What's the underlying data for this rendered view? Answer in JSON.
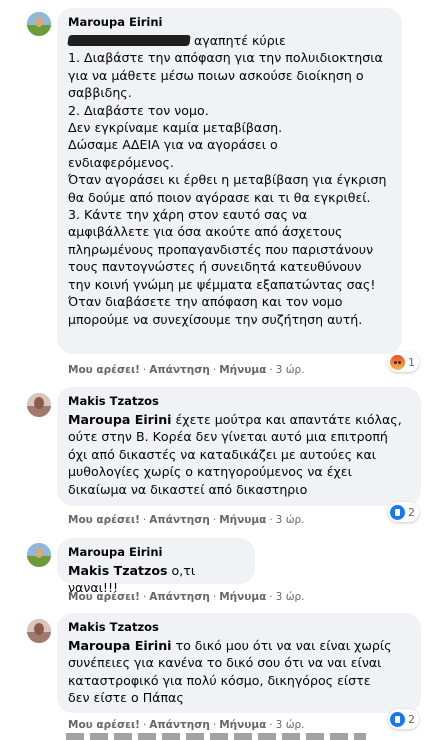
{
  "comments": [
    {
      "author": "Maroupa Eirini",
      "body_prefix": "αγαπητέ κύριε",
      "body": "1. Διαβάστε την απόφαση για την πολυιδιοκτησια\nγια να μάθετε μέσω ποιων ασκούσε διοίκηση ο\nσαββιδης.\n2. Διαβάστε τον νομο.\nΔεν εγκρίναμε καμία μεταβίβαση.\nΔώσαμε ΑΔΕΙΑ για να αγοράσει ο\nενδιαφερόμενος.\nΌταν αγοράσει κι έρθει η μεταβίβαση για έγκριση\nθα δούμε από ποιον αγόρασε και τι θα εγκριθεί.\n3. Κάντε την χάρη στον εαυτό σας να\nαμφιβάλλετε για όσα ακούτε από άσχετους\nπληρωμένους προπαγανδιστές που παριστάνουν\nτους παντογνώστες ή συνειδητά κατευθύνουν\nτην κοινή γνώμη με ψέμματα εξαπατώντας σας!\nΌταν διαβάσετε την απόφαση και τον νομο\nμπορούμε να συνεχίσουμε την συζήτηση αυτή.",
      "like": "Μου αρέσει!",
      "reply": "Απάντηση",
      "message": "Μήνυμα",
      "time": "3 ώρ.",
      "reaction_icon": "angry-reaction-icon",
      "reaction_count": "1"
    },
    {
      "author": "Makis Tzatzos",
      "mention": "Maroupa Eirini",
      "body": " έχετε μούτρα και απαντάτε κιόλας,\nούτε στην Β. Κορέα δεν γίνεται αυτό μια επιτροπή\nόχι από δικαστές να καταδικάζει με αυτούες και\nμυθολογίες χωρίς ο κατηγορούμενος να έχει\nδικαίωμα να δικαστεί από δικαστηριο",
      "like": "Μου αρέσει!",
      "reply": "Απάντηση",
      "message": "Μήνυμα",
      "time": "3 ώρ.",
      "reaction_icon": "like-reaction-icon",
      "reaction_count": "2"
    },
    {
      "author": "Maroupa Eirini",
      "mention": "Makis Tzatzos",
      "body": " ο,τι ναναι!!!",
      "like": "Μου αρέσει!",
      "reply": "Απάντηση",
      "message": "Μήνυμα",
      "time": "3 ώρ."
    },
    {
      "author": "Makis Tzatzos",
      "mention": "Maroupa Eirini",
      "body": " το δικό μου ότι να ναι είναι χωρίς\nσυνέπειες για κανένα το δικό σου ότι να ναι είναι\nκαταστροφικό για πολύ κόσμο, δικηγόρος είστε\nδεν είστε ο Πάπας",
      "like": "Μου αρέσει!",
      "reply": "Απάντηση",
      "message": "Μήνυμα",
      "time": "3 ώρ.",
      "reaction_icon": "like-reaction-icon",
      "reaction_count": "2"
    }
  ],
  "separator": "·"
}
